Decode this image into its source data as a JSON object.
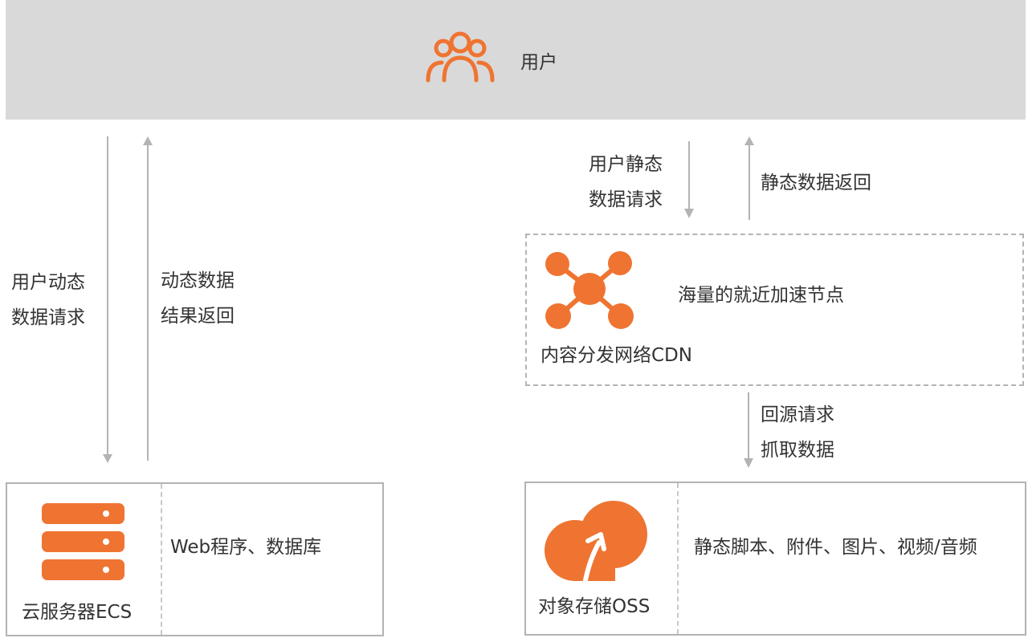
{
  "user": {
    "label": "用户",
    "icon": "users-icon"
  },
  "left_flow": {
    "request_lines": [
      "用户动态",
      "数据请求"
    ],
    "response_lines": [
      "动态数据",
      "结果返回"
    ]
  },
  "right_top_flow": {
    "request_lines": [
      "用户静态",
      "数据请求"
    ],
    "response_label": "静态数据返回"
  },
  "cdn": {
    "name": "内容分发网络CDN",
    "description": "海量的就近加速节点",
    "icon": "network-nodes-icon"
  },
  "origin_flow": {
    "lines": [
      "回源请求",
      "抓取数据"
    ]
  },
  "ecs": {
    "name": "云服务器ECS",
    "description": "Web程序、数据库",
    "icon": "server-stack-icon"
  },
  "oss": {
    "name": "对象存储OSS",
    "description": "静态脚本、附件、图片、视频/音频",
    "icon": "cloud-upload-icon"
  },
  "colors": {
    "accent": "#ef7431",
    "bar": "#d9d9d9",
    "arrow": "#b3b3b3",
    "border": "#b3b3b3",
    "text": "#333333"
  }
}
